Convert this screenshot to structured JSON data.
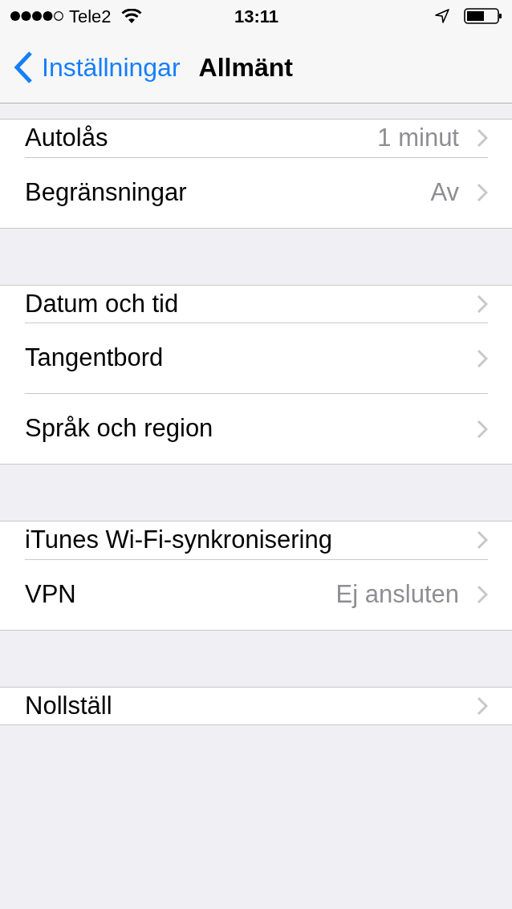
{
  "status_bar": {
    "carrier": "Tele2",
    "time": "13:11"
  },
  "nav": {
    "back": "Inställningar",
    "title": "Allmänt"
  },
  "groups": [
    {
      "rows": [
        {
          "label": "Autolås",
          "value": "1 minut"
        },
        {
          "label": "Begränsningar",
          "value": "Av"
        }
      ]
    },
    {
      "rows": [
        {
          "label": "Datum och tid"
        },
        {
          "label": "Tangentbord"
        },
        {
          "label": "Språk och region"
        }
      ]
    },
    {
      "rows": [
        {
          "label": "iTunes Wi-Fi-synkronisering"
        },
        {
          "label": "VPN",
          "value": "Ej ansluten"
        }
      ]
    },
    {
      "rows": [
        {
          "label": "Nollställ"
        }
      ]
    }
  ]
}
